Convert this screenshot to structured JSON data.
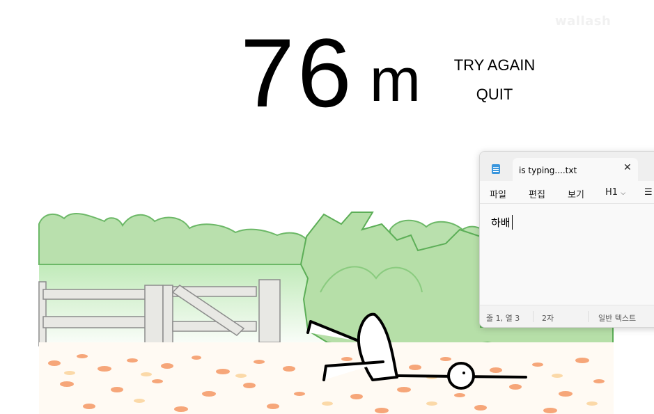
{
  "watermark": "wallash",
  "game": {
    "distance_value": "76",
    "distance_unit": "m",
    "menu": {
      "try_again": "TRY AGAIN",
      "quit": "QUIT"
    }
  },
  "notepad": {
    "tab_title": "is typing....txt",
    "menu": {
      "file": "파일",
      "edit": "편집",
      "view": "보기",
      "heading": "H1"
    },
    "content": "하배",
    "status": {
      "position": "줄 1, 열 3",
      "chars": "2자",
      "format": "일반 텍스트"
    }
  },
  "colors": {
    "foliage_light": "#c5e8b8",
    "foliage_outline": "#5cae57",
    "fence": "#e8e8e4",
    "leaves": "#f6a679",
    "notepad_accent": "#3a96dd"
  }
}
